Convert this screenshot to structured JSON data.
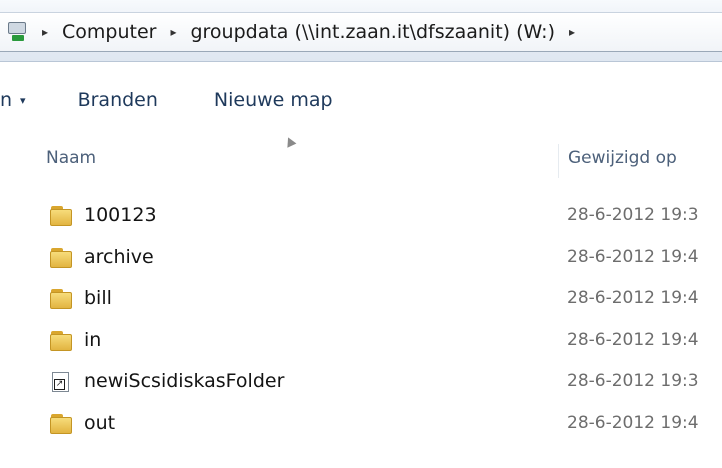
{
  "address": {
    "crumbs": [
      "Computer",
      "groupdata (\\\\int.zaan.it\\dfszaanit) (W:)"
    ],
    "separator": "▸"
  },
  "toolbar": {
    "organize_label": "n",
    "organize_chevron": "▾",
    "burn_label": "Branden",
    "new_folder_label": "Nieuwe map"
  },
  "columns": {
    "name": "Naam",
    "date_modified": "Gewijzigd op"
  },
  "files": [
    {
      "name": "100123",
      "date": "28-6-2012 19:3",
      "type": "folder"
    },
    {
      "name": "archive",
      "date": "28-6-2012 19:4",
      "type": "folder"
    },
    {
      "name": "bill",
      "date": "28-6-2012 19:4",
      "type": "folder"
    },
    {
      "name": "in",
      "date": "28-6-2012 19:4",
      "type": "folder"
    },
    {
      "name": "newiScsidiskasFolder",
      "date": "28-6-2012 19:3",
      "type": "shortcut"
    },
    {
      "name": "out",
      "date": "28-6-2012 19:4",
      "type": "folder"
    }
  ],
  "icons": {
    "drive": "network-drive-icon",
    "folder": "folder-icon",
    "shortcut": "shortcut-icon"
  },
  "colors": {
    "toolbar_text": "#1e395b",
    "header_text": "#4c607a",
    "date_text": "#6d6d6d"
  }
}
